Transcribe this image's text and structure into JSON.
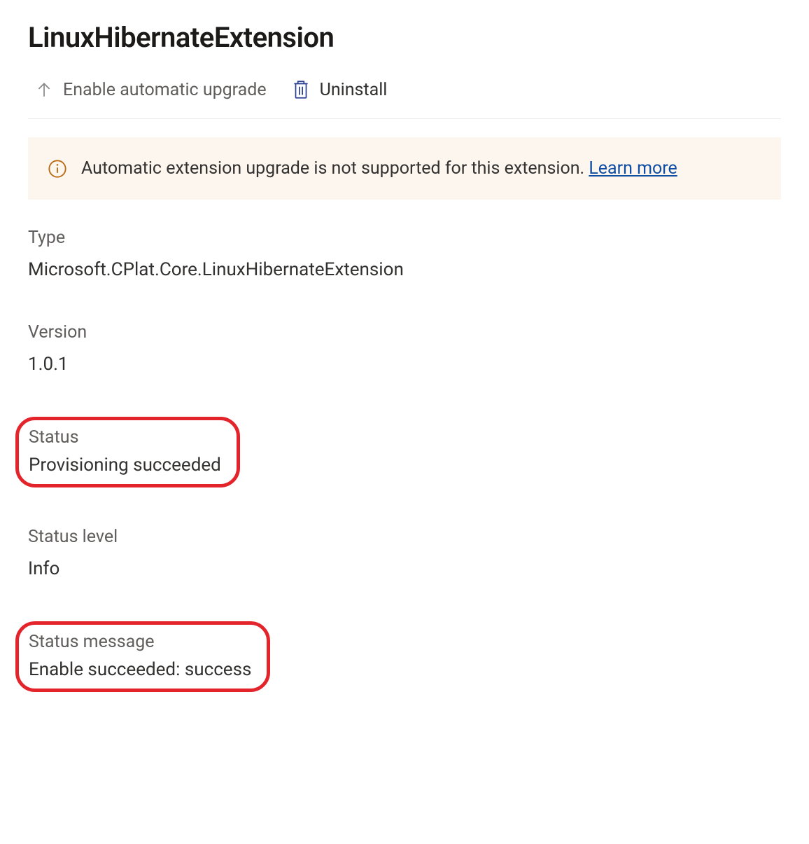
{
  "title": "LinuxHibernateExtension",
  "toolbar": {
    "enable_upgrade_label": "Enable automatic upgrade",
    "uninstall_label": "Uninstall"
  },
  "info_bar": {
    "message": "Automatic extension upgrade is not supported for this extension.",
    "learn_more_label": "Learn more"
  },
  "fields": {
    "type": {
      "label": "Type",
      "value": "Microsoft.CPlat.Core.LinuxHibernateExtension"
    },
    "version": {
      "label": "Version",
      "value": "1.0.1"
    },
    "status": {
      "label": "Status",
      "value": "Provisioning succeeded"
    },
    "status_level": {
      "label": "Status level",
      "value": "Info"
    },
    "status_message": {
      "label": "Status message",
      "value": "Enable succeeded: success"
    }
  },
  "colors": {
    "highlight": "#e3242b",
    "info_bg": "#fdf6ee",
    "info_icon": "#b96b12",
    "link": "#0f4da3",
    "toolbar_icon_gray": "#8a8886",
    "toolbar_icon_blue": "#2a3e92"
  }
}
